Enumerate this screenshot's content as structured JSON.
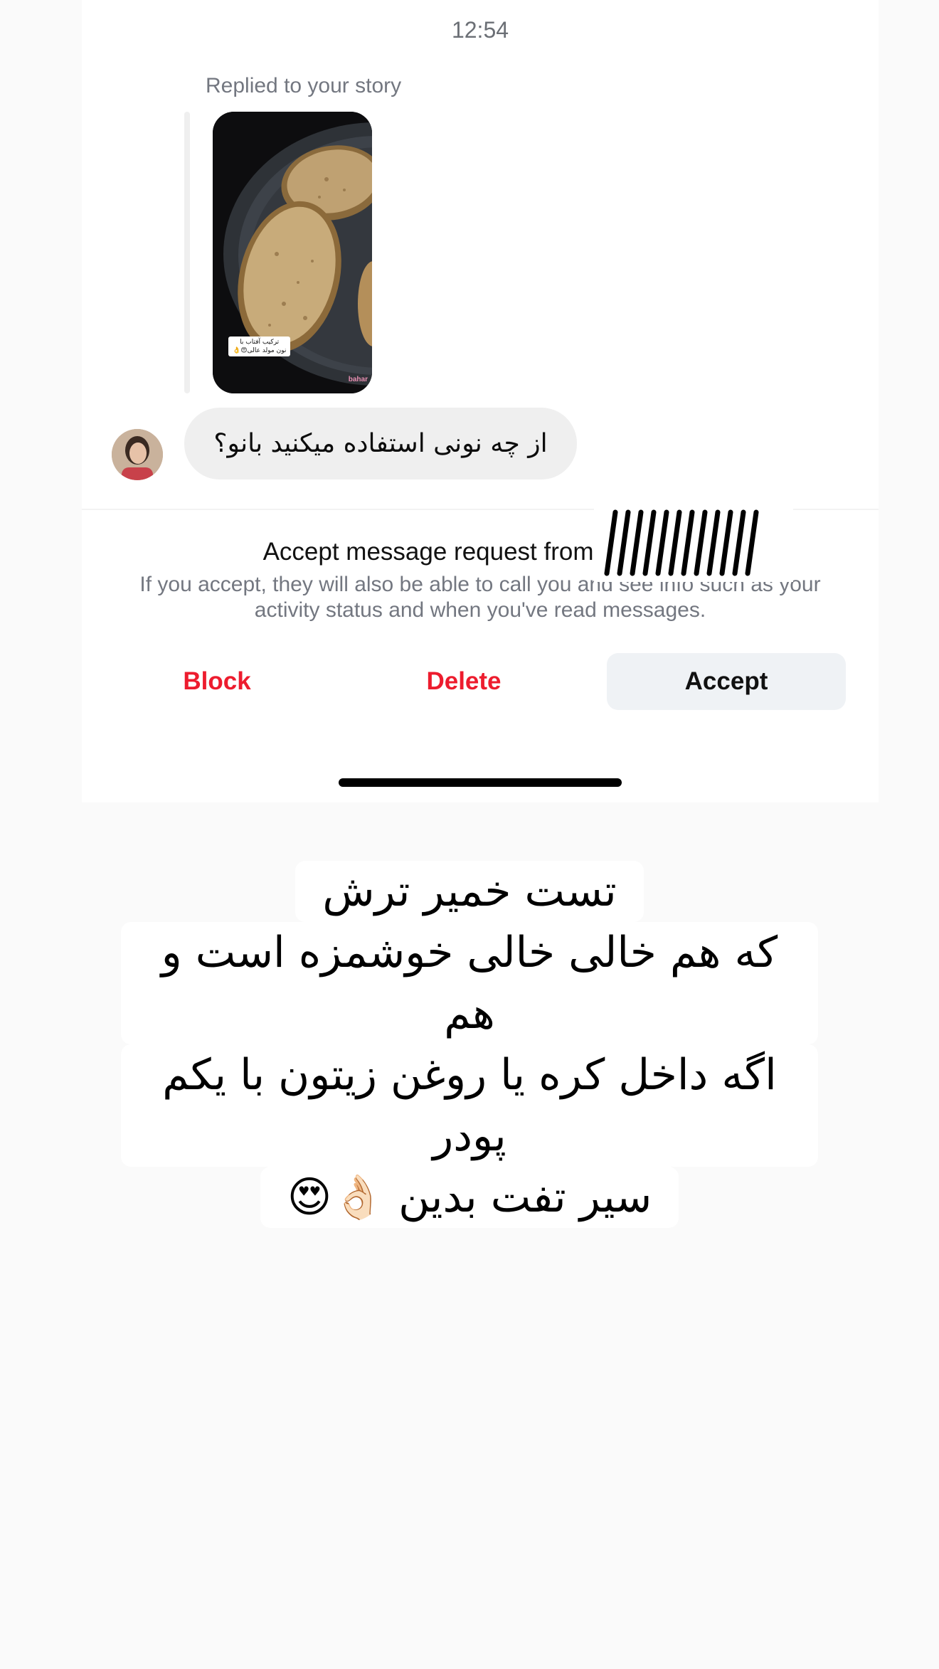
{
  "status_bar": {
    "time": "12:54"
  },
  "story_reply": {
    "label": "Replied to your story",
    "thumbnail_caption": "ترکیب آفتاب با\nنون مولد عالی😍👌",
    "thumbnail_logo": "bahar"
  },
  "message": {
    "text": "از چه نونی استفاده میکنید بانو؟"
  },
  "request": {
    "title": "Accept message request from mary_4",
    "title_suffix": "?",
    "description": "If you accept, they will also be able to call you and see info such as your activity status and when you've read messages."
  },
  "actions": {
    "block": "Block",
    "delete": "Delete",
    "accept": "Accept"
  },
  "overlay_text": {
    "line1": "تست خمیر ترش",
    "line2": "که هم خالی خالی خوشمزه است و هم",
    "line3": "اگه داخل کره یا روغن زیتون با یکم پودر",
    "line4": "سیر تفت بدین 👌🏻😍"
  },
  "colors": {
    "destructive": "#ed1c2e",
    "accept_bg": "#eff2f5",
    "bubble_bg": "#efefef"
  }
}
